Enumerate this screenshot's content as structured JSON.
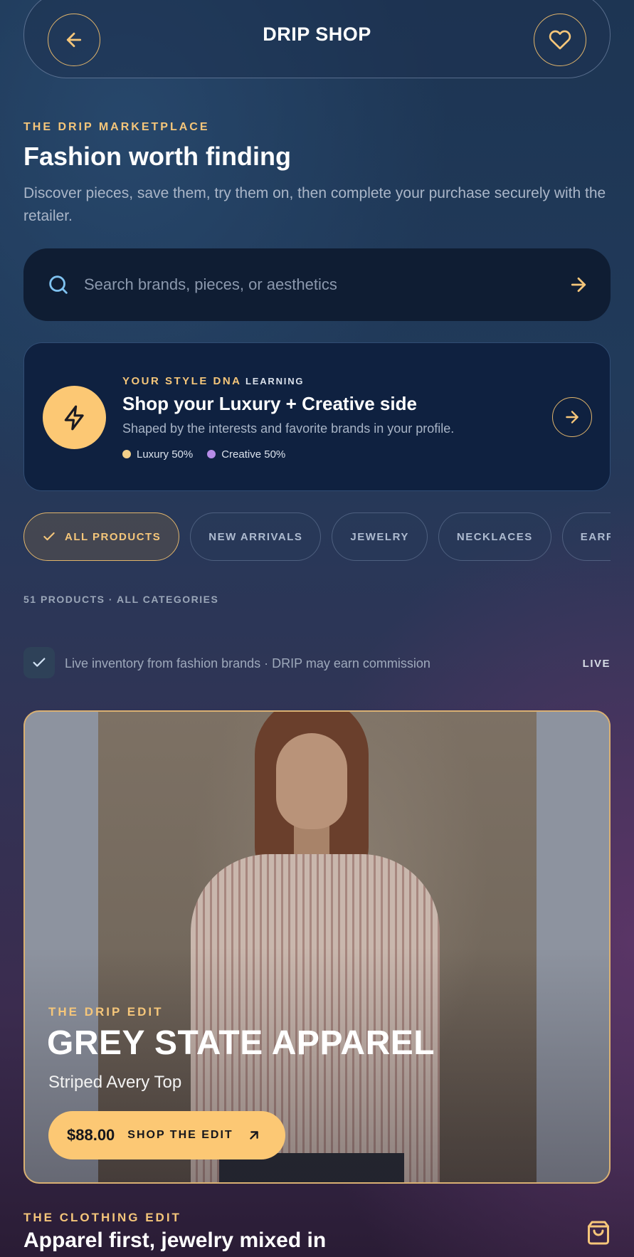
{
  "header": {
    "title": "DRIP SHOP"
  },
  "intro": {
    "eyebrow": "THE DRIP MARKETPLACE",
    "title": "Fashion worth finding",
    "description": "Discover pieces, save them, try them on, then complete your purchase securely with the retailer."
  },
  "search": {
    "placeholder": "Search brands, pieces, or aesthetics"
  },
  "style_dna": {
    "label": "YOUR STYLE DNA",
    "badge": "LEARNING",
    "headline": "Shop your Luxury + Creative side",
    "subtitle": "Shaped by the interests and favorite brands in your profile.",
    "traits": [
      {
        "label": "Luxury 50%",
        "color": "#f3d08a"
      },
      {
        "label": "Creative 50%",
        "color": "#b68ce8"
      }
    ]
  },
  "filters": [
    {
      "label": "ALL PRODUCTS",
      "active": true
    },
    {
      "label": "NEW ARRIVALS",
      "active": false
    },
    {
      "label": "JEWELRY",
      "active": false
    },
    {
      "label": "NECKLACES",
      "active": false
    },
    {
      "label": "EARRINGS",
      "active": false
    }
  ],
  "summary": "51 PRODUCTS · ALL CATEGORIES",
  "inventory": {
    "text": "Live inventory from fashion brands · DRIP may earn commission",
    "status": "LIVE"
  },
  "featured": {
    "eyebrow": "THE DRIP EDIT",
    "brand": "GREY STATE APPAREL",
    "product": "Striped Avery Top",
    "price": "$88.00",
    "cta": "SHOP THE EDIT"
  },
  "next_section": {
    "eyebrow": "THE CLOTHING EDIT",
    "title": "Apparel first, jewelry mixed in"
  },
  "colors": {
    "accent": "#fcc874",
    "accent_border": "#e0b46b"
  }
}
